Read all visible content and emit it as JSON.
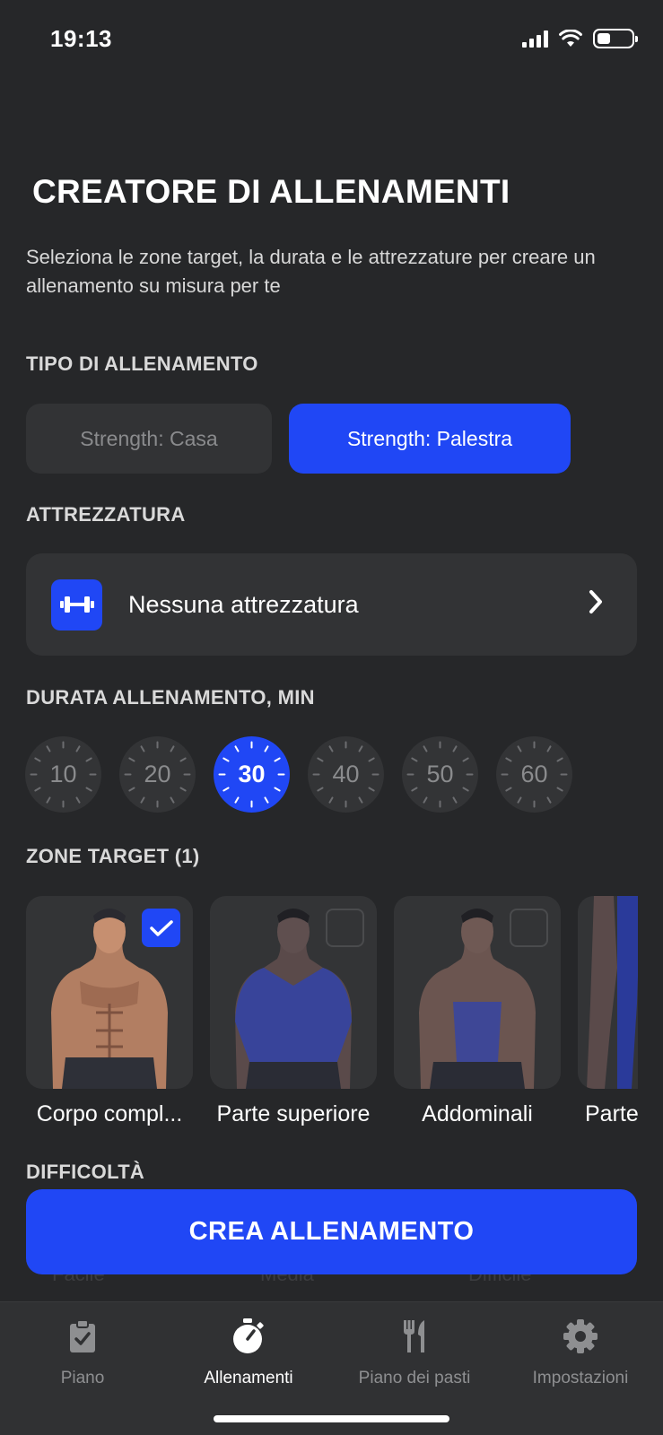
{
  "status": {
    "time": "19:13",
    "battery_level": 0.3
  },
  "header": {
    "title": "CREATORE DI ALLENAMENTI",
    "subtitle": "Seleziona le zone target, la durata e le attrezzature per creare un allenamento su misura per te"
  },
  "workout_type": {
    "label": "TIPO DI ALLENAMENTO",
    "options": [
      "Strength: Casa",
      "Strength: Palestra"
    ],
    "selected": "Strength: Palestra"
  },
  "equipment": {
    "label": "ATTREZZATURA",
    "value": "Nessuna attrezzatura",
    "icon": "dumbbell-icon"
  },
  "duration": {
    "label": "DURATA ALLENAMENTO, MIN",
    "options": [
      "10",
      "20",
      "30",
      "40",
      "50",
      "60"
    ],
    "selected": "30"
  },
  "zones": {
    "label": "ZONE TARGET (1)",
    "items": [
      {
        "label": "Corpo compl...",
        "checked": true
      },
      {
        "label": "Parte superiore",
        "checked": false
      },
      {
        "label": "Addominali",
        "checked": false
      },
      {
        "label": "Parte",
        "checked": false
      }
    ]
  },
  "difficulty": {
    "label": "DIFFICOLTÀ",
    "options": [
      "Facile",
      "Media",
      "Difficile"
    ]
  },
  "cta": {
    "label": "CREA ALLENAMENTO"
  },
  "tabbar": {
    "items": [
      {
        "label": "Piano",
        "icon": "clipboard-icon"
      },
      {
        "label": "Allenamenti",
        "icon": "stopwatch-icon"
      },
      {
        "label": "Piano dei pasti",
        "icon": "fork-knife-icon"
      },
      {
        "label": "Impostazioni",
        "icon": "gear-icon"
      }
    ],
    "active": "Allenamenti"
  },
  "colors": {
    "accent": "#2047f5",
    "background": "#262729",
    "card": "#333436"
  }
}
